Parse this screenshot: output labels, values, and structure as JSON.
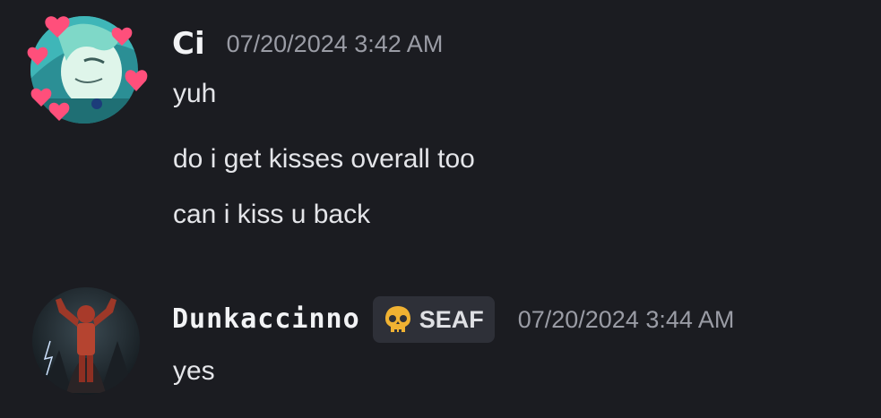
{
  "messages": [
    {
      "author": "Ci",
      "timestamp": "07/20/2024 3:42 AM",
      "avatar": "anime-girl-avatar",
      "lines": [
        "yuh",
        "do i get kisses overall too",
        "can i kiss u back"
      ]
    },
    {
      "author": "Dunkaccinno",
      "tag": {
        "icon": "skull-icon",
        "label": "SEAF"
      },
      "timestamp": "07/20/2024 3:44 AM",
      "avatar": "hero-figure-avatar",
      "lines": [
        "yes"
      ]
    }
  ],
  "colors": {
    "background": "#1b1c21",
    "username": "#f2f3f5",
    "timestamp": "#9a9ca5",
    "message_text": "#e4e5e9",
    "tag_background": "#2e3038",
    "heart": "#ff4f7b"
  }
}
